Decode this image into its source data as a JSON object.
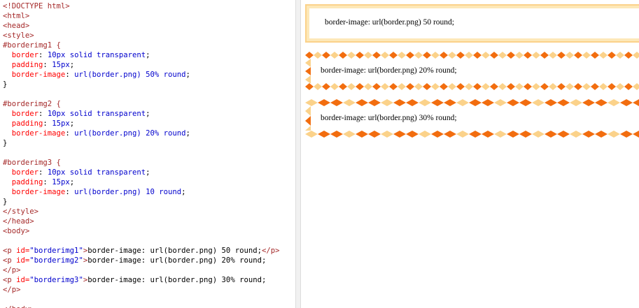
{
  "editor": {
    "lines": [
      [
        {
          "c": "tag",
          "t": "<!DOCTYPE html>"
        }
      ],
      [
        {
          "c": "tag",
          "t": "<html>"
        }
      ],
      [
        {
          "c": "tag",
          "t": "<head>"
        }
      ],
      [
        {
          "c": "tag",
          "t": "<style>"
        }
      ],
      [
        {
          "c": "sel",
          "t": "#borderimg1 {"
        }
      ],
      [
        {
          "c": "txt",
          "t": "  "
        },
        {
          "c": "prop",
          "t": "border"
        },
        {
          "c": "txt",
          "t": ": "
        },
        {
          "c": "pval",
          "t": "10px solid transparent"
        },
        {
          "c": "txt",
          "t": ";"
        }
      ],
      [
        {
          "c": "txt",
          "t": "  "
        },
        {
          "c": "prop",
          "t": "padding"
        },
        {
          "c": "txt",
          "t": ": "
        },
        {
          "c": "pval",
          "t": "15px"
        },
        {
          "c": "txt",
          "t": ";"
        }
      ],
      [
        {
          "c": "txt",
          "t": "  "
        },
        {
          "c": "prop",
          "t": "border-image"
        },
        {
          "c": "txt",
          "t": ": "
        },
        {
          "c": "pval",
          "t": "url(border.png) 50% round"
        },
        {
          "c": "txt",
          "t": ";"
        }
      ],
      [
        {
          "c": "txt",
          "t": "}"
        }
      ],
      [
        {
          "c": "txt",
          "t": ""
        }
      ],
      [
        {
          "c": "sel",
          "t": "#borderimg2 {"
        }
      ],
      [
        {
          "c": "txt",
          "t": "  "
        },
        {
          "c": "prop",
          "t": "border"
        },
        {
          "c": "txt",
          "t": ": "
        },
        {
          "c": "pval",
          "t": "10px solid transparent"
        },
        {
          "c": "txt",
          "t": ";"
        }
      ],
      [
        {
          "c": "txt",
          "t": "  "
        },
        {
          "c": "prop",
          "t": "padding"
        },
        {
          "c": "txt",
          "t": ": "
        },
        {
          "c": "pval",
          "t": "15px"
        },
        {
          "c": "txt",
          "t": ";"
        }
      ],
      [
        {
          "c": "txt",
          "t": "  "
        },
        {
          "c": "prop",
          "t": "border-image"
        },
        {
          "c": "txt",
          "t": ": "
        },
        {
          "c": "pval",
          "t": "url(border.png) 20% round"
        },
        {
          "c": "txt",
          "t": ";"
        }
      ],
      [
        {
          "c": "txt",
          "t": "}"
        }
      ],
      [
        {
          "c": "txt",
          "t": ""
        }
      ],
      [
        {
          "c": "sel",
          "t": "#borderimg3 {"
        }
      ],
      [
        {
          "c": "txt",
          "t": "  "
        },
        {
          "c": "prop",
          "t": "border"
        },
        {
          "c": "txt",
          "t": ": "
        },
        {
          "c": "pval",
          "t": "10px solid transparent"
        },
        {
          "c": "txt",
          "t": ";"
        }
      ],
      [
        {
          "c": "txt",
          "t": "  "
        },
        {
          "c": "prop",
          "t": "padding"
        },
        {
          "c": "txt",
          "t": ": "
        },
        {
          "c": "pval",
          "t": "15px"
        },
        {
          "c": "txt",
          "t": ";"
        }
      ],
      [
        {
          "c": "txt",
          "t": "  "
        },
        {
          "c": "prop",
          "t": "border-image"
        },
        {
          "c": "txt",
          "t": ": "
        },
        {
          "c": "pval",
          "t": "url(border.png) 10 round"
        },
        {
          "c": "txt",
          "t": ";"
        }
      ],
      [
        {
          "c": "txt",
          "t": "}"
        }
      ],
      [
        {
          "c": "tag",
          "t": "</style>"
        }
      ],
      [
        {
          "c": "tag",
          "t": "</head>"
        }
      ],
      [
        {
          "c": "tag",
          "t": "<body>"
        }
      ],
      [
        {
          "c": "txt",
          "t": ""
        }
      ],
      [
        {
          "c": "tag",
          "t": "<p "
        },
        {
          "c": "attr",
          "t": "id="
        },
        {
          "c": "val",
          "t": "\"borderimg1\""
        },
        {
          "c": "tag",
          "t": ">"
        },
        {
          "c": "txt",
          "t": "border-image: url(border.png) 50 round;"
        },
        {
          "c": "tag",
          "t": "</p>"
        }
      ],
      [
        {
          "c": "tag",
          "t": "<p "
        },
        {
          "c": "attr",
          "t": "id="
        },
        {
          "c": "val",
          "t": "\"borderimg2\""
        },
        {
          "c": "tag",
          "t": ">"
        },
        {
          "c": "txt",
          "t": "border-image: url(border.png) 20% round;"
        }
      ],
      [
        {
          "c": "tag",
          "t": "</p>"
        }
      ],
      [
        {
          "c": "tag",
          "t": "<p "
        },
        {
          "c": "attr",
          "t": "id="
        },
        {
          "c": "val",
          "t": "\"borderimg3\""
        },
        {
          "c": "tag",
          "t": ">"
        },
        {
          "c": "txt",
          "t": "border-image: url(border.png) 30% round;"
        }
      ],
      [
        {
          "c": "tag",
          "t": "</p>"
        }
      ],
      [
        {
          "c": "txt",
          "t": ""
        }
      ],
      [
        {
          "c": "tag",
          "t": "</body>"
        }
      ]
    ]
  },
  "preview": {
    "box1_text": "border-image: url(border.png) 50 round;",
    "box2_text": "border-image: url(border.png) 20% round;",
    "box3_text": "border-image: url(border.png) 30% round;"
  },
  "colors": {
    "light_orange": "#fbd28a",
    "dark_orange": "#f26d0f",
    "pale": "#fde8b8"
  }
}
